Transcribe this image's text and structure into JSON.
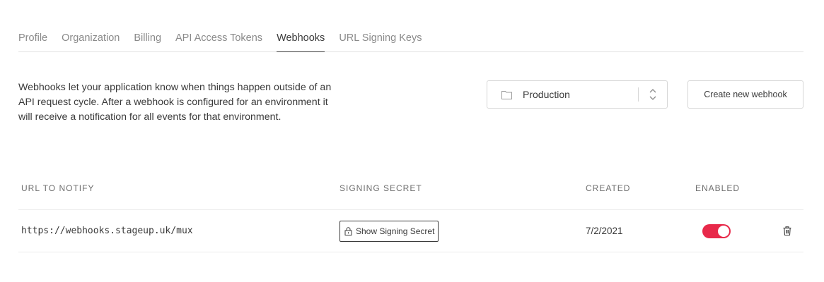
{
  "tabs": [
    {
      "label": "Profile"
    },
    {
      "label": "Organization"
    },
    {
      "label": "Billing"
    },
    {
      "label": "API Access Tokens"
    },
    {
      "label": "Webhooks",
      "active": true
    },
    {
      "label": "URL Signing Keys"
    }
  ],
  "description": "Webhooks let your application know when things happen outside of an API request cycle. After a webhook is configured for an environment it will receive a notification for all events for that environment.",
  "environment_select": {
    "value": "Production",
    "icon": "folder-icon",
    "chevron": "up-down-chevron-icon"
  },
  "create_button": {
    "label": "Create new webhook"
  },
  "table": {
    "headers": {
      "url": "URL TO NOTIFY",
      "secret": "SIGNING SECRET",
      "created": "CREATED",
      "enabled": "ENABLED"
    },
    "rows": [
      {
        "url": "https://webhooks.stageup.uk/mux",
        "secret_button": "Show Signing Secret",
        "created": "7/2/2021",
        "enabled": true
      }
    ]
  },
  "colors": {
    "toggle_on": "#e8294a",
    "text": "#3a3a3a",
    "muted": "#8a8a8a"
  }
}
